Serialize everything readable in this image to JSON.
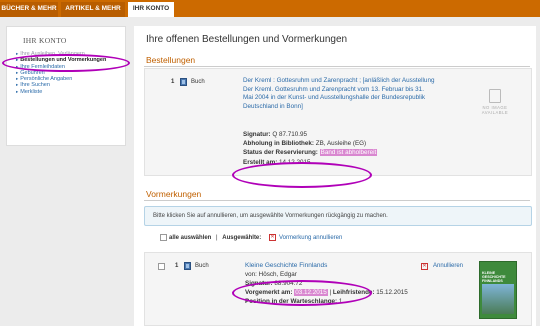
{
  "nav": {
    "tabs": [
      {
        "label": "BÜCHER & MEHR"
      },
      {
        "label": "ARTIKEL & MEHR"
      },
      {
        "label": "IHR KONTO"
      }
    ],
    "active_tab": "IHR KONTO"
  },
  "sidebar": {
    "title": "IHR KONTO",
    "items": [
      {
        "label": "Ihre Ausleihen, Verlängern"
      },
      {
        "label": "Bestellungen und Vormerkungen"
      },
      {
        "label": "Ihre Fernleihdaten"
      },
      {
        "label": "Gebühren"
      },
      {
        "label": "Persönliche Angaben"
      },
      {
        "label": "Ihre Suchen"
      },
      {
        "label": "Merkliste"
      }
    ]
  },
  "main": {
    "title": "Ihre offenen Bestellungen und Vormerkungen",
    "orders": {
      "heading": "Bestellungen",
      "item": {
        "number": "1",
        "media_type": "Buch",
        "title": "Der Kreml : Gottesruhm und Zarenpracht ; [anläßlich der Ausstellung Der Kreml. Gottesruhm und Zarenpracht vom 13. Februar bis 31. Mai 2004 in der Kunst- und Ausstellungshalle der Bundesrepublik Deutschland in Bonn]",
        "signature_label": "Signatur:",
        "signature": "Q 87.710.95",
        "pickup_label": "Abholung in Bibliothek:",
        "pickup": "ZB, Ausleihe (EG)",
        "status_label": "Status der Reservierung:",
        "status": "Band ist abholbereit",
        "created_label": "Erstellt am:",
        "created": "14.12.2015",
        "no_image": "NO IMAGE AVAILABLE"
      }
    },
    "reservations": {
      "heading": "Vormerkungen",
      "info": "Bitte klicken Sie auf annullieren, um ausgewählte Vormerkungen rückgängig zu machen.",
      "select_all": "alle auswählen",
      "separator": "|",
      "selected_label": "Ausgewählte:",
      "cancel_selected": "Vormerkung annullieren",
      "item": {
        "number": "1",
        "media_type": "Buch",
        "title": "Kleine Geschichte Finnlands",
        "author": "von: Hösch, Edgar",
        "signature_label": "Signatur:",
        "signature": "88.904.72",
        "reserved_label": "Vorgemerkt am:",
        "reserved": "03.12.2015",
        "loan_period_label": "Leihfristende:",
        "loan_period": "15.12.2015",
        "queue_label": "Position in der Warteschlange:",
        "queue": "1",
        "cancel": "Annullieren",
        "cover_title": "KLEINE GESCHICHTE FINNLANDS"
      }
    }
  },
  "colors": {
    "brand_orange": "#cc6a00",
    "link_blue": "#2a6aa8",
    "annotation_magenta": "#b000b8",
    "status_highlight": "#d987d0"
  }
}
